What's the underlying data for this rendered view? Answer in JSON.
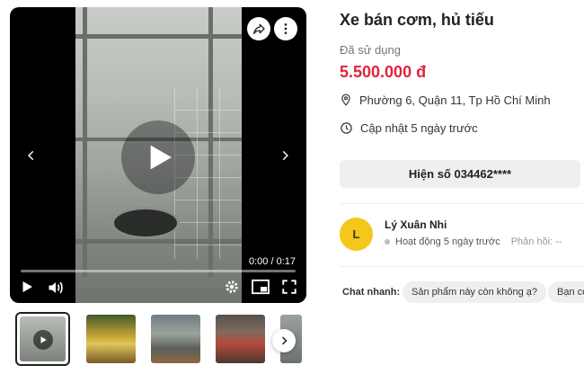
{
  "listing": {
    "title": "Xe bán cơm, hủ tiếu",
    "condition": "Đã sử dụng",
    "price": "5.500.000 đ",
    "location": "Phường 6, Quận 11, Tp Hồ Chí Minh",
    "updated": "Cập nhật 5 ngày trước",
    "phone_button": "Hiện số 034462****"
  },
  "player": {
    "time": "0:00 / 0:17",
    "progress_fraction": 0
  },
  "seller": {
    "initial": "L",
    "name": "Lý Xuân Nhi",
    "activity": "Hoạt động 5 ngày trước",
    "reply": "Phản hồi: --"
  },
  "chat": {
    "label": "Chat nhanh:",
    "chips": [
      "Sản phẩm này còn không ạ?",
      "Bạn có"
    ]
  },
  "colors": {
    "price": "#e0243a",
    "avatar": "#f5c71a"
  },
  "icons": [
    "share-icon",
    "more-icon",
    "chevron-left-icon",
    "chevron-right-icon",
    "play-icon",
    "volume-icon",
    "settings-icon",
    "pip-icon",
    "fullscreen-icon",
    "location-pin-icon",
    "clock-icon"
  ]
}
